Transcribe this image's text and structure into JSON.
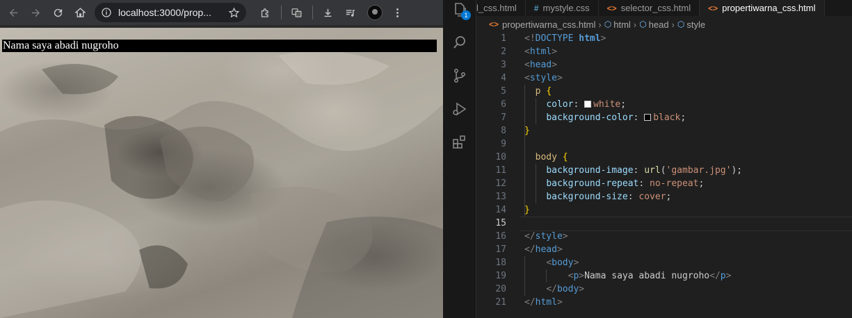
{
  "browser": {
    "url": "localhost:3000/prop...",
    "page_paragraph": "Nama saya abadi nugroho"
  },
  "vscode": {
    "notification_count": "1",
    "tabs": [
      {
        "label": "l_css.html",
        "type": "html"
      },
      {
        "label": "mystyle.css",
        "type": "css"
      },
      {
        "label": "selector_css.html",
        "type": "html"
      },
      {
        "label": "propertiwarna_css.html",
        "type": "html",
        "active": true
      }
    ],
    "breadcrumb": {
      "file": "propertiwarna_css.html",
      "items": [
        "html",
        "head",
        "style"
      ]
    },
    "current_line": 15,
    "lines": [
      {
        "n": "1",
        "text": "<!DOCTYPE html>"
      },
      {
        "n": "2",
        "text": "<html>"
      },
      {
        "n": "3",
        "text": "<head>"
      },
      {
        "n": "4",
        "text": "<style>"
      },
      {
        "n": "5",
        "text": "  p {"
      },
      {
        "n": "6",
        "text": "    color: white;"
      },
      {
        "n": "7",
        "text": "    background-color: black;"
      },
      {
        "n": "8",
        "text": "}"
      },
      {
        "n": "9",
        "text": ""
      },
      {
        "n": "10",
        "text": "  body {"
      },
      {
        "n": "11",
        "text": "    background-image: url('gambar.jpg');"
      },
      {
        "n": "12",
        "text": "    background-repeat: no-repeat;"
      },
      {
        "n": "13",
        "text": "    background-size: cover;"
      },
      {
        "n": "14",
        "text": "}"
      },
      {
        "n": "15",
        "text": ""
      },
      {
        "n": "16",
        "text": "</style>"
      },
      {
        "n": "17",
        "text": "</head>"
      },
      {
        "n": "18",
        "text": "    <body>"
      },
      {
        "n": "19",
        "text": "        <p>Nama saya abadi nugroho</p>"
      },
      {
        "n": "20",
        "text": "    </body>"
      },
      {
        "n": "21",
        "text": "</html>"
      }
    ],
    "swatch_colors": {
      "white": "#ffffff",
      "black": "#000000"
    }
  }
}
